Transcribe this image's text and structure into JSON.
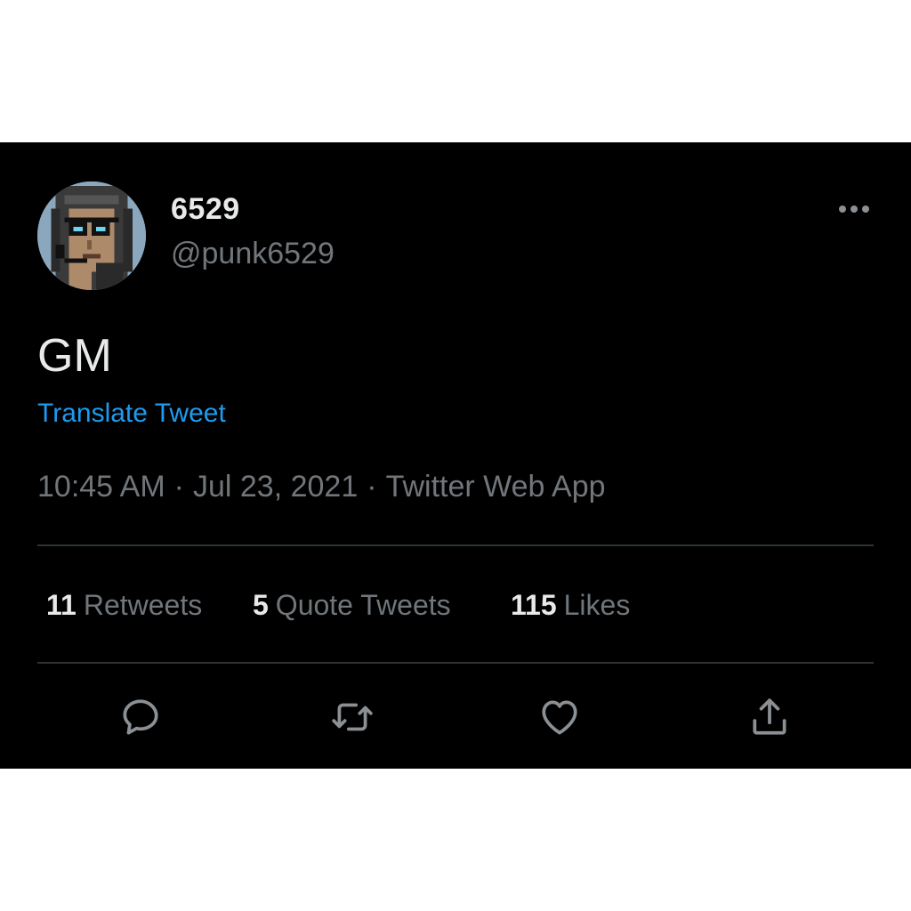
{
  "tweet": {
    "author": {
      "display_name": "6529",
      "handle": "@punk6529",
      "avatar_icon": "pixel-punk-avatar"
    },
    "text": "GM",
    "translate_label": "Translate Tweet",
    "time": "10:45 AM",
    "date": "Jul 23, 2021",
    "source": "Twitter Web App",
    "separator": "·",
    "more_icon": "more-horizontal-icon"
  },
  "stats": {
    "retweets": {
      "count": "11",
      "label": "Retweets"
    },
    "quote_tweets": {
      "count": "5",
      "label": "Quote Tweets"
    },
    "likes": {
      "count": "115",
      "label": "Likes"
    }
  },
  "actions": [
    {
      "name": "reply",
      "icon": "speech-bubble-icon"
    },
    {
      "name": "retweet",
      "icon": "retweet-arrows-icon"
    },
    {
      "name": "like",
      "icon": "heart-icon"
    },
    {
      "name": "share",
      "icon": "share-upload-icon"
    }
  ],
  "colors": {
    "background": "#000000",
    "text_primary": "#e7e9ea",
    "text_secondary": "#71767b",
    "link": "#1d9bf0",
    "divider": "#2f3336"
  }
}
